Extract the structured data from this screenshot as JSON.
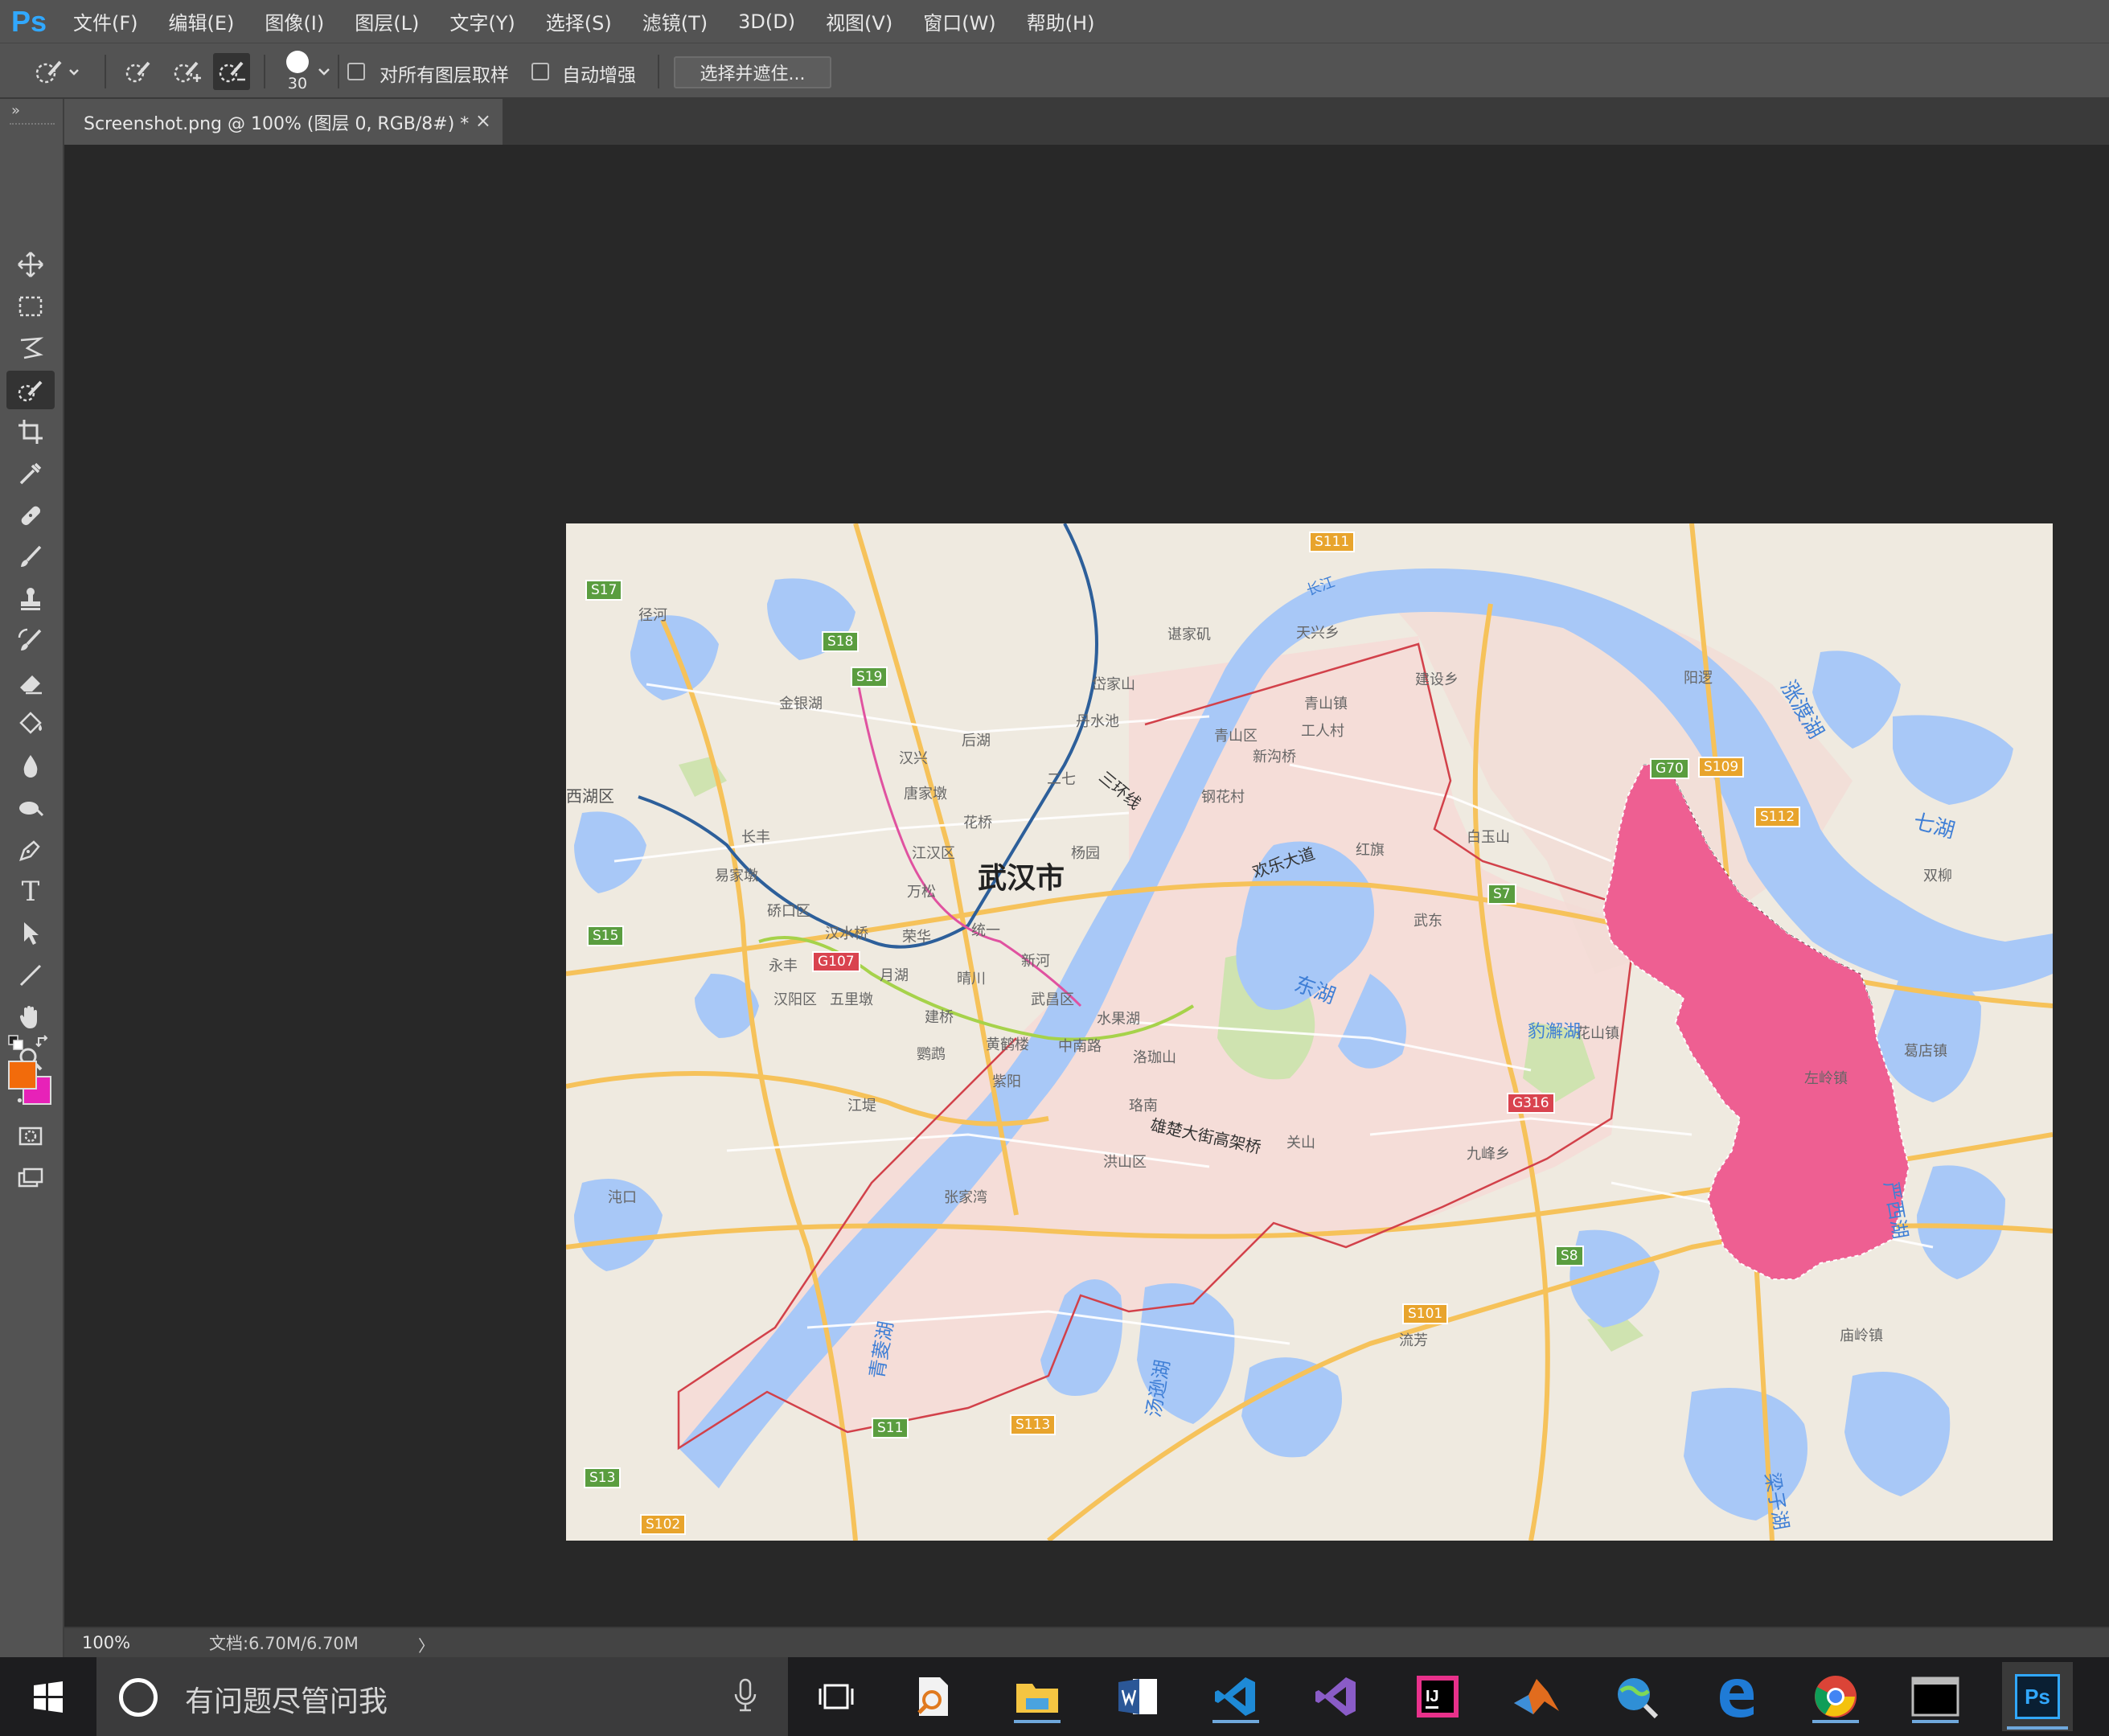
{
  "app": {
    "logo": "Ps"
  },
  "menu": [
    "文件(F)",
    "编辑(E)",
    "图像(I)",
    "图层(L)",
    "文字(Y)",
    "选择(S)",
    "滤镜(T)",
    "3D(D)",
    "视图(V)",
    "窗口(W)",
    "帮助(H)"
  ],
  "options": {
    "brush_size": "30",
    "sample_all_layers": "对所有图层取样",
    "auto_enhance": "自动增强",
    "select_and_mask": "选择并遮住..."
  },
  "document_tab": {
    "title": "Screenshot.png @ 100% (图层 0, RGB/8#) *",
    "close": "×"
  },
  "toolbar": {
    "tools": [
      "move-tool",
      "marquee-tool",
      "lasso-tool",
      "quick-selection-tool",
      "crop-tool",
      "eyedropper-tool",
      "healing-brush-tool",
      "brush-tool",
      "clone-stamp-tool",
      "history-brush-tool",
      "eraser-tool",
      "paint-bucket-tool",
      "blur-tool",
      "dodge-tool",
      "pen-tool",
      "type-tool",
      "path-selection-tool",
      "line-tool",
      "hand-tool",
      "zoom-tool",
      "more-tools"
    ],
    "type_glyph": "T",
    "more_glyph": "•••",
    "foreground_color": "#f26b0b",
    "background_color": "#e722b8"
  },
  "status": {
    "zoom": "100%",
    "doc": "文档:6.70M/6.70M",
    "arrow": "〉"
  },
  "taskbar": {
    "search_placeholder": "有问题尽管问我",
    "apps": [
      "task-view",
      "search-app",
      "file-explorer",
      "office-app",
      "vscode",
      "visual-studio",
      "intellij",
      "matlab",
      "globe-app",
      "edge",
      "chrome",
      "terminal",
      "photoshop"
    ],
    "ps_label": "Ps"
  },
  "map": {
    "city": "武汉市",
    "labels": [
      {
        "text": "径河"
      },
      {
        "text": "金银湖"
      },
      {
        "text": "西湖区"
      },
      {
        "text": "长丰"
      },
      {
        "text": "易家墩"
      },
      {
        "text": "硚口区"
      },
      {
        "text": "汉水桥"
      },
      {
        "text": "永丰"
      },
      {
        "text": "汉阳区"
      },
      {
        "text": "五里墩"
      },
      {
        "text": "汉兴"
      },
      {
        "text": "唐家墩"
      },
      {
        "text": "后湖"
      },
      {
        "text": "谌家矶"
      },
      {
        "text": "岱家山"
      },
      {
        "text": "丹水池"
      },
      {
        "text": "二七"
      },
      {
        "text": "花桥"
      },
      {
        "text": "江汉区"
      },
      {
        "text": "万松"
      },
      {
        "text": "荣华"
      },
      {
        "text": "统一"
      },
      {
        "text": "月湖"
      },
      {
        "text": "晴川"
      },
      {
        "text": "新河"
      },
      {
        "text": "杨园"
      },
      {
        "text": "武昌区"
      },
      {
        "text": "建桥"
      },
      {
        "text": "黄鹤楼"
      },
      {
        "text": "中南路"
      },
      {
        "text": "水果湖"
      },
      {
        "text": "鹦鹉"
      },
      {
        "text": "紫阳"
      },
      {
        "text": "洛珈山"
      },
      {
        "text": "江堤"
      },
      {
        "text": "珞南"
      },
      {
        "text": "洪山区"
      },
      {
        "text": "关山"
      },
      {
        "text": "张家湾"
      },
      {
        "text": "沌口"
      },
      {
        "text": "天兴乡"
      },
      {
        "text": "青山镇"
      },
      {
        "text": "青山区"
      },
      {
        "text": "工人村"
      },
      {
        "text": "新沟桥"
      },
      {
        "text": "钢花村"
      },
      {
        "text": "建设乡"
      },
      {
        "text": "白玉山"
      },
      {
        "text": "红旗"
      },
      {
        "text": "武东"
      },
      {
        "text": "花山镇"
      },
      {
        "text": "九峰乡"
      },
      {
        "text": "流芳"
      },
      {
        "text": "阳逻"
      },
      {
        "text": "双柳"
      },
      {
        "text": "葛店镇"
      },
      {
        "text": "左岭镇"
      },
      {
        "text": "庙岭镇"
      },
      {
        "text": "东湖"
      },
      {
        "text": "汤逊湖"
      },
      {
        "text": "青菱湖"
      },
      {
        "text": "梁子湖"
      },
      {
        "text": "七湖"
      },
      {
        "text": "涨渡湖"
      },
      {
        "text": "严西湖"
      },
      {
        "text": "豹澥湖"
      },
      {
        "text": "长江"
      },
      {
        "text": "三环线"
      },
      {
        "text": "欢乐大道"
      },
      {
        "text": "雄楚大街高架桥"
      }
    ],
    "shields": [
      {
        "text": "S17",
        "kind": "green"
      },
      {
        "text": "S18",
        "kind": "green"
      },
      {
        "text": "S19",
        "kind": "green"
      },
      {
        "text": "S15",
        "kind": "green"
      },
      {
        "text": "S13",
        "kind": "green"
      },
      {
        "text": "S11",
        "kind": "green"
      },
      {
        "text": "S7",
        "kind": "green"
      },
      {
        "text": "G70",
        "kind": "green"
      },
      {
        "text": "S8",
        "kind": "green"
      },
      {
        "text": "S111",
        "kind": "orange"
      },
      {
        "text": "S109",
        "kind": "orange"
      },
      {
        "text": "S112",
        "kind": "orange"
      },
      {
        "text": "S113",
        "kind": "orange"
      },
      {
        "text": "S101",
        "kind": "orange"
      },
      {
        "text": "S102",
        "kind": "orange"
      },
      {
        "text": "G107",
        "kind": "red"
      },
      {
        "text": "G316",
        "kind": "red"
      }
    ]
  }
}
